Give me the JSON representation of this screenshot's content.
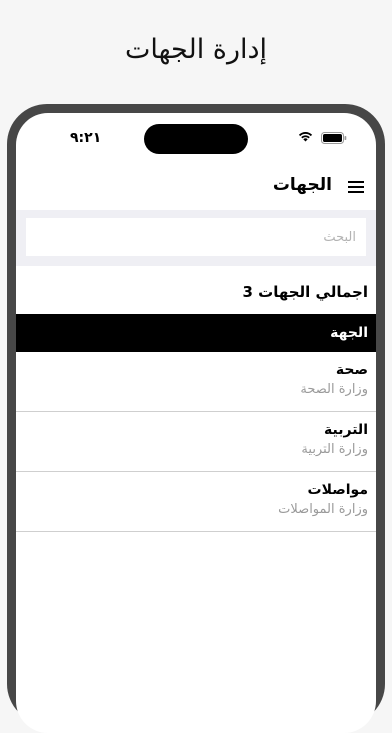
{
  "promo": {
    "title": "إدارة الجهات"
  },
  "status": {
    "time": "٩:٢١"
  },
  "nav": {
    "title": "الجهات"
  },
  "search": {
    "placeholder": "البحث",
    "value": ""
  },
  "summary": {
    "total_label": "اجمالي الجهات 3"
  },
  "table": {
    "header": "الجهة"
  },
  "entities": [
    {
      "name": "صحة",
      "ministry": "وزارة الصحة"
    },
    {
      "name": "التربية",
      "ministry": "وزارة التربية"
    },
    {
      "name": "مواصلات",
      "ministry": "وزارة المواصلات"
    }
  ],
  "colors": {
    "header_bg": "#000000",
    "search_bg": "#efeff4",
    "subtext": "#9a9a9a"
  },
  "icons": [
    "menu-icon",
    "wifi-icon",
    "battery-icon"
  ]
}
